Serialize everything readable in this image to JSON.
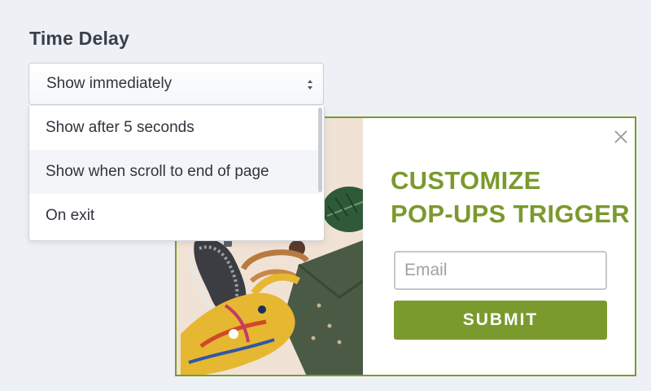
{
  "settings": {
    "title": "Time Delay",
    "selected_value": "Show immediately",
    "options": [
      {
        "label": "Show after 5 seconds"
      },
      {
        "label": "Show when scroll to end of page"
      },
      {
        "label": "On exit"
      }
    ]
  },
  "popup": {
    "headline_line1": "CUSTOMIZE",
    "headline_line2": "POP-UPS TRIGGER",
    "email_placeholder": "Email",
    "submit_label": "SUBMIT",
    "close_icon": "close-icon"
  },
  "colors": {
    "accent": "#7a9a2d",
    "background": "#edf1f5",
    "option_hover": "#f3f5f8"
  }
}
